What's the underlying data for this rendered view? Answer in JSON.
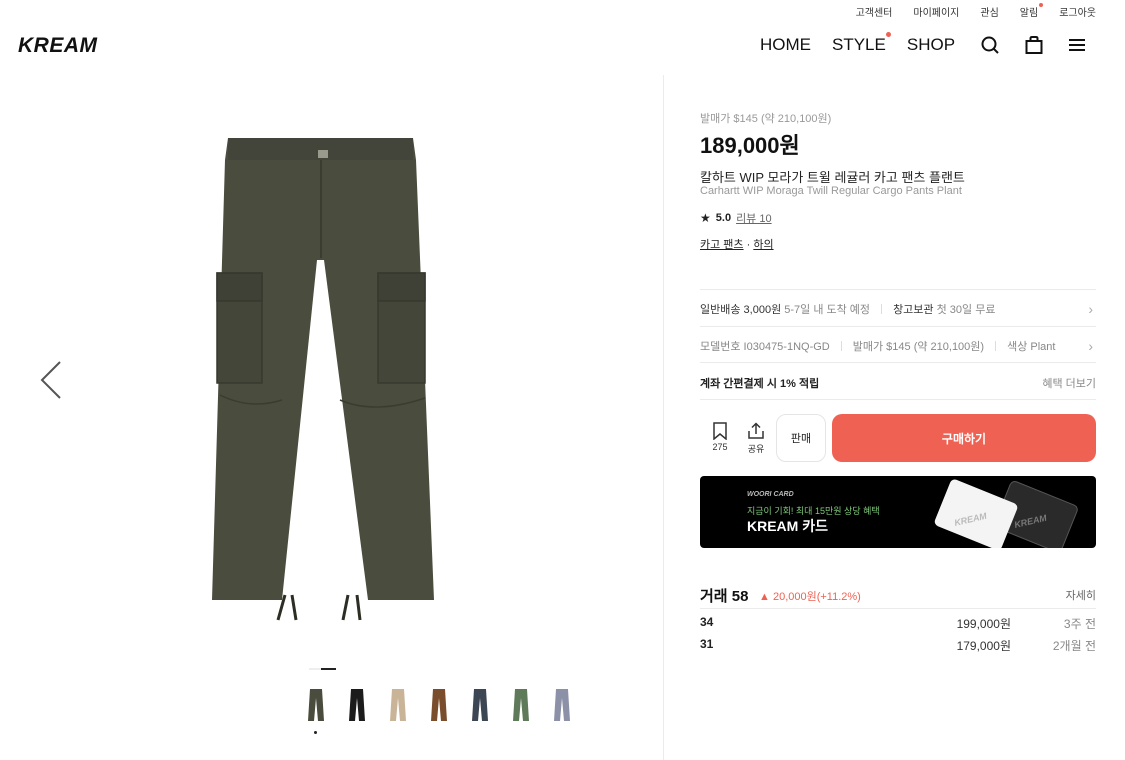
{
  "util_nav": [
    "고객센터",
    "마이페이지",
    "관심",
    "알림",
    "로그아웃"
  ],
  "logo": "KREAM",
  "nav": [
    "HOME",
    "STYLE",
    "SHOP"
  ],
  "product": {
    "release_price": "발매가 $145 (약 210,100원)",
    "price": "189,000원",
    "name_ko": "칼하트 WIP 모라가 트윌 레귤러 카고 팬츠 플랜트",
    "name_en": "Carhartt WIP Moraga Twill Regular Cargo Pants Plant",
    "rating": "5.0",
    "review": "리뷰 10",
    "category1": "카고 팬츠",
    "category_sep": " · ",
    "category2": "하의",
    "main_color": "#4a4c3d"
  },
  "thumbs": [
    {
      "color": "#4a4c3d"
    },
    {
      "color": "#1c1c1c"
    },
    {
      "color": "#c9b498"
    },
    {
      "color": "#7a4e2d"
    },
    {
      "color": "#3d4653"
    },
    {
      "color": "#5f7a58"
    },
    {
      "color": "#8d91a8"
    }
  ],
  "shipping": {
    "label": "일반배송",
    "price": "3,000원",
    "eta": "5-7일 내 도착 예정",
    "storage_label": "창고보관",
    "storage_desc": "첫 30일 무료"
  },
  "info": {
    "model": "모델번호 I030475-1NQ-GD",
    "release": "발매가 $145 (약 210,100원)",
    "color": "색상 Plant"
  },
  "benefit": {
    "label": "계좌 간편결제 시 1% 적립",
    "more": "혜택 더보기"
  },
  "actions": {
    "bookmark_count": "275",
    "share_label": "공유",
    "sell_label": "판매",
    "buy_label": "구매하기"
  },
  "banner": {
    "brand": "WOORI CARD",
    "promo": "지금이 기회! 최대 15만원 상당 혜택",
    "cardname": "KREAM 카드",
    "card_logo": "KREAM"
  },
  "trades": {
    "title": "거래 58",
    "change": "20,000원(+11.2%)",
    "more": "자세히",
    "rows": [
      {
        "size": "34",
        "price": "199,000원",
        "when": "3주 전"
      },
      {
        "size": "31",
        "price": "179,000원",
        "when": "2개월 전"
      }
    ]
  }
}
